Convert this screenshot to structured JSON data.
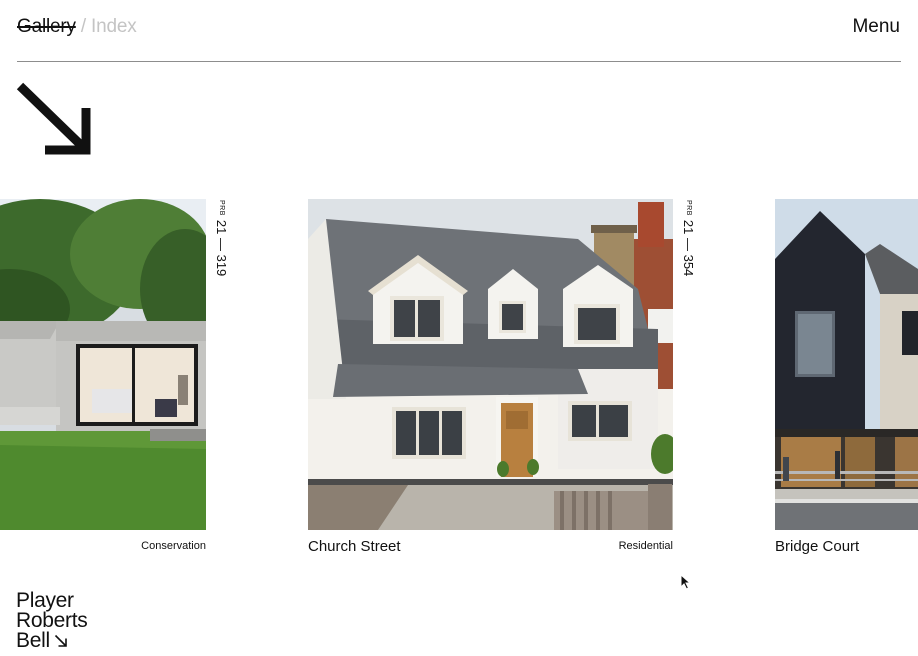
{
  "header": {
    "nav_gallery": "Gallery",
    "nav_separator": " / ",
    "nav_index": "Index",
    "menu_label": "Menu"
  },
  "projects": [
    {
      "code_prefix": "PRB",
      "code": "21 — 319",
      "title": "",
      "category": "Conservation"
    },
    {
      "code_prefix": "PRB",
      "code": "21 — 354",
      "title": "Church Street",
      "category": "Residential"
    },
    {
      "title": "Bridge Court"
    }
  ],
  "logo": {
    "line1": "Player",
    "line2": "Roberts",
    "line3": "Bell"
  },
  "icons": {
    "hero_arrow": "arrow-down-right-icon",
    "logo_arrow": "arrow-down-right-icon",
    "cursor": "mouse-pointer-icon"
  },
  "colors": {
    "text": "#111111",
    "muted": "#c4c4c4",
    "rule": "#8d8d8d",
    "background": "#ffffff"
  }
}
